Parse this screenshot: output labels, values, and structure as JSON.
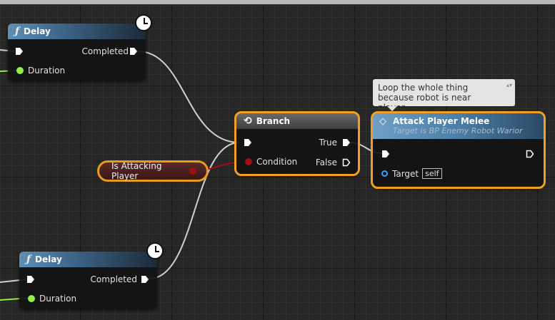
{
  "nodes": {
    "delay_top": {
      "title": "Delay",
      "completed": "Completed",
      "duration": "Duration"
    },
    "delay_bottom": {
      "title": "Delay",
      "completed": "Completed",
      "duration": "Duration"
    },
    "branch": {
      "title": "Branch",
      "condition": "Condition",
      "true_label": "True",
      "false_label": "False"
    },
    "attack": {
      "title": "Attack Player Melee",
      "subtitle": "Target is BP Enemy Robot Warior",
      "target": "Target",
      "target_value": "self"
    },
    "variable": {
      "label": "Is Attacking Player"
    }
  },
  "comment": {
    "text": "Loop the whole thing because robot is near player."
  },
  "colors": {
    "exec": "#ffffff",
    "bool": "#a01010",
    "float": "#8ff04a",
    "object": "#3aa0ff",
    "selection": "#f0a020",
    "function_header": "#4b7ea6"
  },
  "icons": [
    "function-icon",
    "clock-icon",
    "branch-icon",
    "event-icon",
    "exec-pin-icon"
  ]
}
